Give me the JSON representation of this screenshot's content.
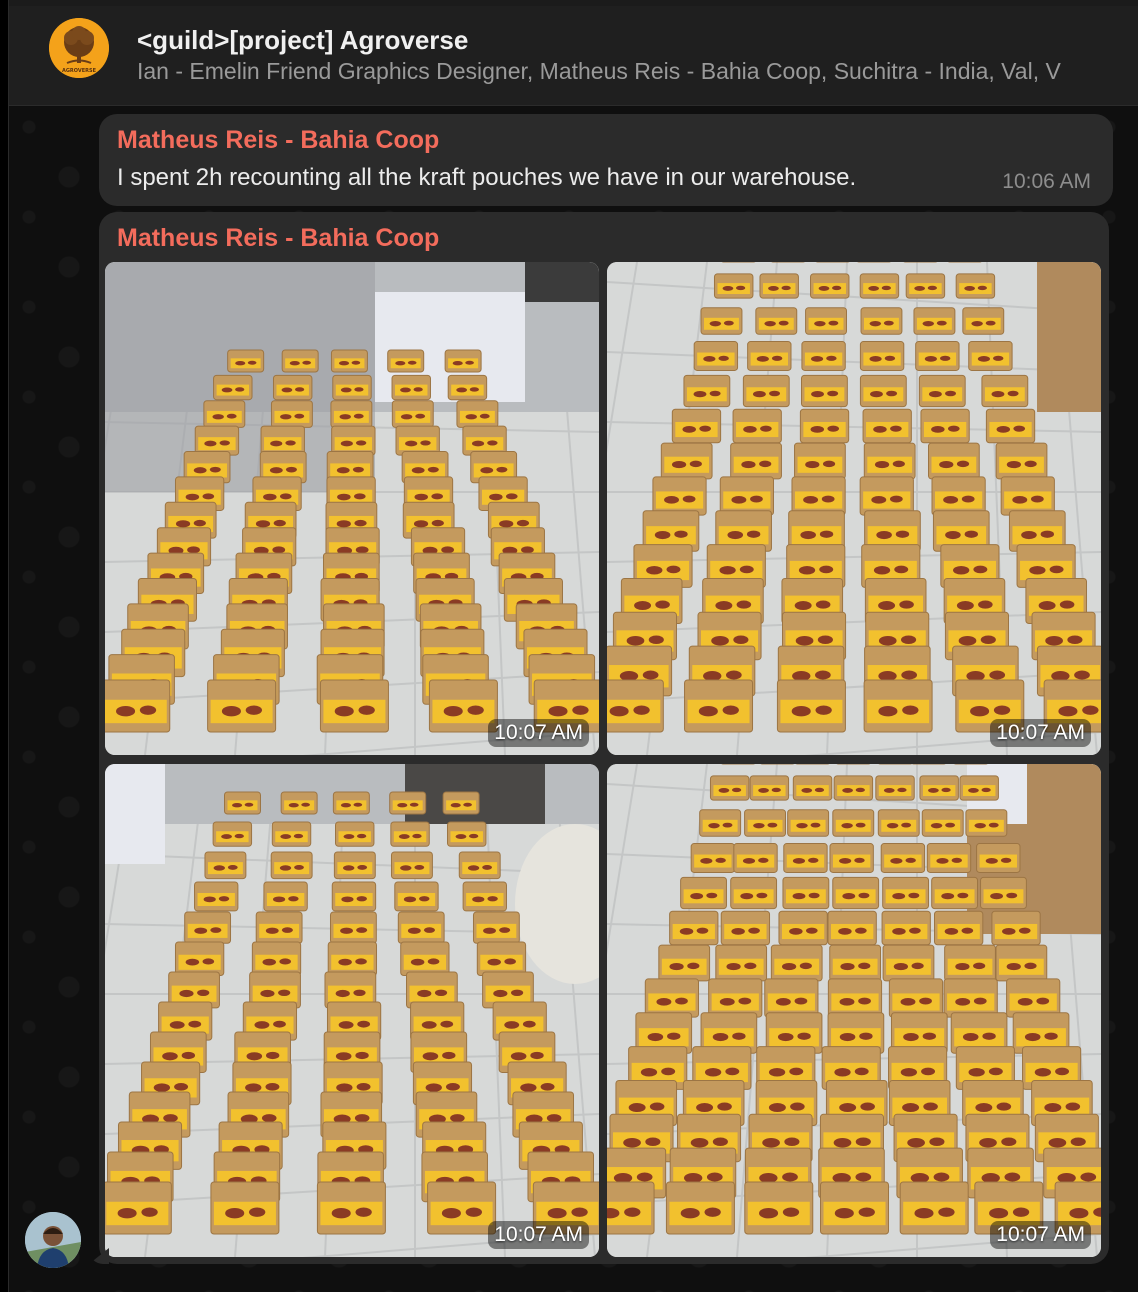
{
  "header": {
    "title": "<guild>[project] Agroverse",
    "members": "Ian - Emelin Friend Graphics Designer, Matheus Reis - Bahia Coop, Suchitra - India, Val, V",
    "avatar_text": "AGROVERSE"
  },
  "messages": [
    {
      "sender": "Matheus Reis - Bahia Coop",
      "text": "I spent 2h recounting all the kraft pouches we have in our warehouse.",
      "time": "10:06 AM"
    },
    {
      "sender": "Matheus Reis - Bahia Coop",
      "photos": [
        {
          "time": "10:07 AM"
        },
        {
          "time": "10:07 AM"
        },
        {
          "time": "10:07 AM"
        },
        {
          "time": "10:07 AM"
        }
      ]
    }
  ],
  "colors": {
    "sender": "#f36c5c",
    "bubble": "#2b2b2b",
    "header": "#1f1f1f",
    "pouch": "#c49a5e",
    "label": "#f2c12e"
  },
  "icons": [
    "agroverse-tree-logo",
    "user-avatar"
  ]
}
